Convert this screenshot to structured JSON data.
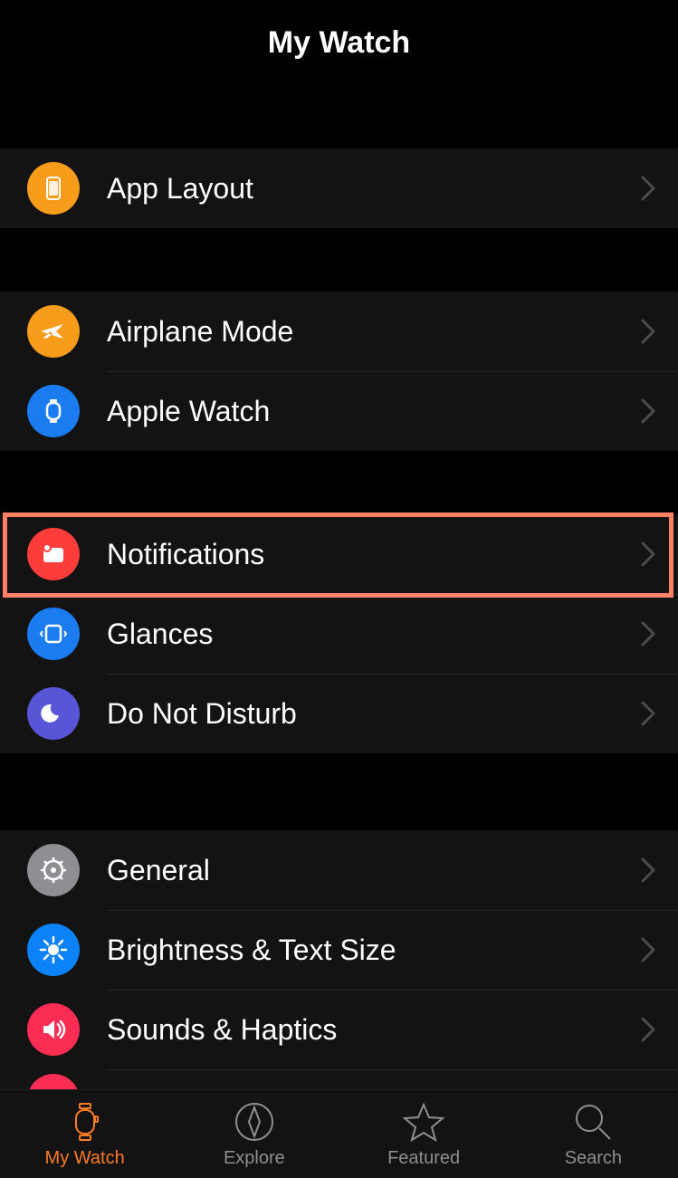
{
  "header": {
    "title": "My Watch"
  },
  "sections": {
    "layout": {
      "app_layout": "App Layout"
    },
    "connect": {
      "airplane": "Airplane Mode",
      "watch": "Apple Watch"
    },
    "alerts": {
      "notifications": "Notifications",
      "glances": "Glances",
      "dnd": "Do Not Disturb"
    },
    "settings": {
      "general": "General",
      "brightness": "Brightness & Text Size",
      "sounds": "Sounds & Haptics"
    }
  },
  "tabs": {
    "mywatch": "My Watch",
    "explore": "Explore",
    "featured": "Featured",
    "search": "Search"
  },
  "highlighted": "notifications",
  "colors": {
    "accent": "#fd7b22",
    "highlight_border": "#fb8267"
  }
}
